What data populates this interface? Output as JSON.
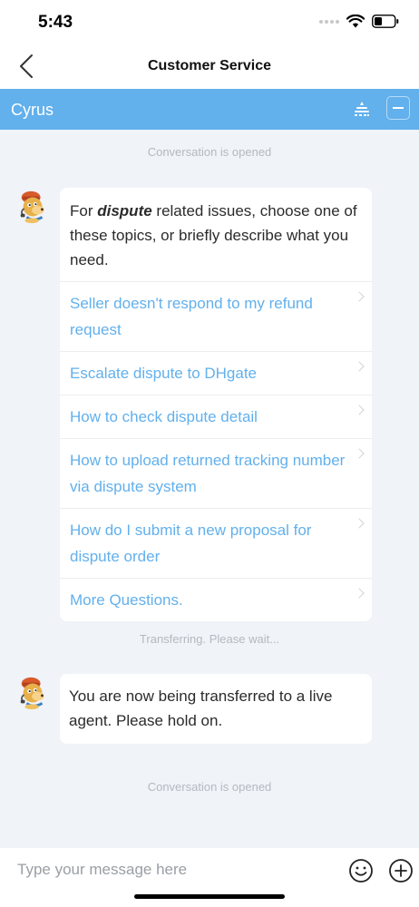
{
  "status_bar": {
    "time": "5:43"
  },
  "nav": {
    "title": "Customer Service"
  },
  "agent": {
    "name": "Cyrus"
  },
  "chat": {
    "system_opened_1": "Conversation is opened",
    "message1": {
      "prefix": "For ",
      "keyword": "dispute",
      "suffix": " related issues, choose one of these topics, or briefly describe what you need.",
      "topics": [
        "Seller doesn't respond to my refund request",
        "Escalate dispute to DHgate",
        "How to check dispute detail",
        "How to upload returned tracking number via dispute system",
        "How do I submit a new proposal for dispute order",
        "More Questions."
      ]
    },
    "system_transferring": "Transferring. Please wait...",
    "message2": {
      "text": "You are now being transferred to a live agent. Please hold on."
    },
    "system_opened_2": "Conversation is opened"
  },
  "input": {
    "placeholder": "Type your message here"
  },
  "colors": {
    "accent": "#62b0ec",
    "background": "#f0f3f8",
    "system_text": "#b4b9c0"
  }
}
